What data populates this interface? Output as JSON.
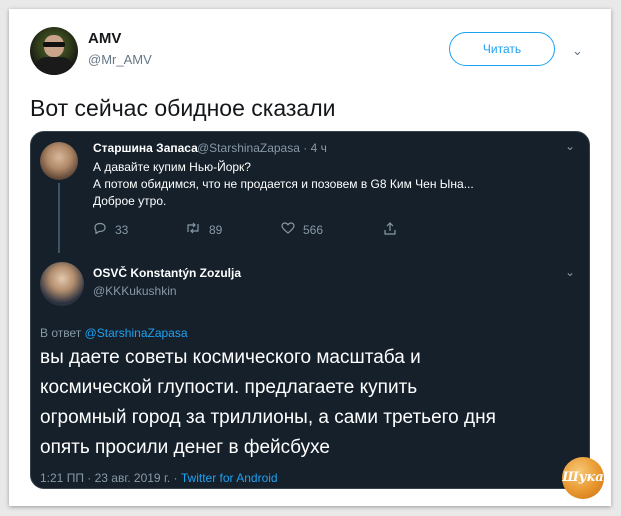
{
  "tweet": {
    "author_name": "AMV",
    "author_handle": "@Mr_AMV",
    "follow_label": "Читать",
    "text": "Вот сейчас обидное сказали"
  },
  "quoted": {
    "author_name": "Старшина Запаса",
    "author_handle": "@StarshinaZapasa · 4 ч",
    "lines": [
      "А давайте купим Нью-Йорк?",
      "А потом обидимся, что не продается и позовем в G8 Ким Чен Ына...",
      "Доброе утро."
    ],
    "actions": {
      "replies": "33",
      "retweets": "89",
      "likes": "566"
    }
  },
  "reply": {
    "author_name": "OSVČ Konstantýn Zozulja",
    "author_handle": "@KKKukushkin",
    "reply_prefix": "В ответ",
    "reply_to": "@StarshinaZapasa",
    "lines": [
      "вы даете советы космического масштаба и",
      "космической глупости. предлагаете купить",
      "огромный город за триллионы, а сами третьего дня",
      "опять просили денег в фейсбухе"
    ],
    "meta": "1:21 ПП · 23 авг. 2019 г. ·",
    "source": "Twitter for Android"
  },
  "watermark": "Шука",
  "colors": {
    "accent": "#1da1f2",
    "dark_bg": "#15202b"
  }
}
